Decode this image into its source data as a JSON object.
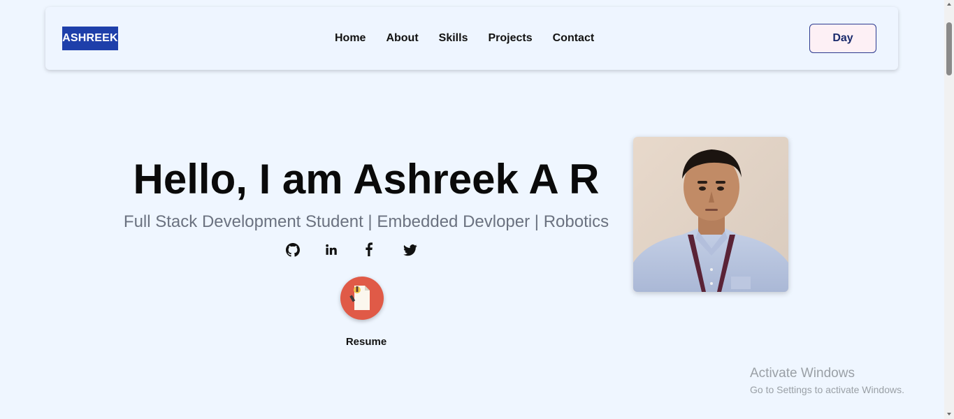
{
  "navbar": {
    "logo": "ASHREEK",
    "links": [
      "Home",
      "About",
      "Skills",
      "Projects",
      "Contact"
    ],
    "theme_button": "Day"
  },
  "hero": {
    "title": "Hello, I am Ashreek A R",
    "subtitle": "Full Stack Development Student | Embedded Devloper | Robotics",
    "social_icons": [
      "github-icon",
      "linkedin-icon",
      "facebook-icon",
      "twitter-icon"
    ],
    "resume_label": "Resume"
  },
  "profile_image": "profile-photo",
  "watermark": {
    "title": "Activate Windows",
    "subtitle": "Go to Settings to activate Windows."
  },
  "colors": {
    "background": "#eff6ff",
    "logo_bg": "#1e3faa",
    "resume_bg": "#e05a47",
    "subtitle": "#6b7280"
  }
}
